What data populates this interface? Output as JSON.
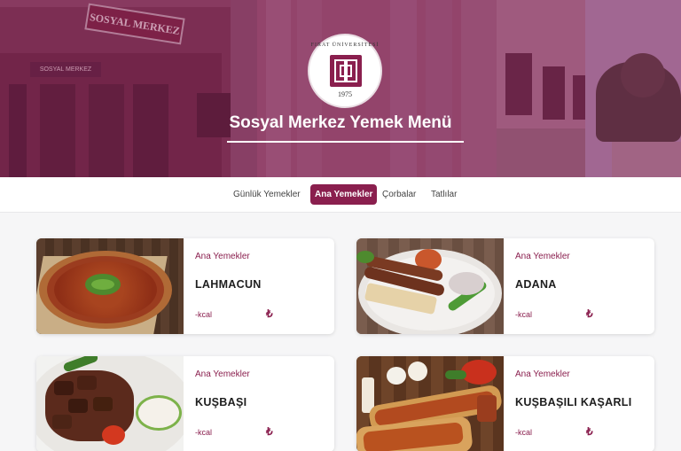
{
  "hero": {
    "title": "Sosyal Merkez Yemek Menü",
    "building_sign": "SOSYAL MERKEZ",
    "building_sign_small": "SOSYAL MERKEZ",
    "logo_text": "FIRAT ÜNİVERSİTESİ",
    "logo_year": "1975"
  },
  "tabs": [
    {
      "label": "Günlük Yemekler",
      "active": false
    },
    {
      "label": "Ana Yemekler",
      "active": true
    },
    {
      "label": "Çorbalar",
      "active": false
    },
    {
      "label": "Tatlılar",
      "active": false
    }
  ],
  "cards": [
    {
      "category": "Ana Yemekler",
      "name": "LAHMACUN",
      "kcal": "-kcal",
      "currency": "₺",
      "image": "lahmacun"
    },
    {
      "category": "Ana Yemekler",
      "name": "ADANA",
      "kcal": "-kcal",
      "currency": "₺",
      "image": "adana"
    },
    {
      "category": "Ana Yemekler",
      "name": "KUŞBAŞI",
      "kcal": "-kcal",
      "currency": "₺",
      "image": "kusbasi"
    },
    {
      "category": "Ana Yemekler",
      "name": "KUŞBAŞILI KAŞARLI",
      "kcal": "-kcal",
      "currency": "₺",
      "image": "kusbasili-kasarli"
    }
  ],
  "colors": {
    "brand": "#8a1f4e",
    "background": "#f6f6f7"
  }
}
